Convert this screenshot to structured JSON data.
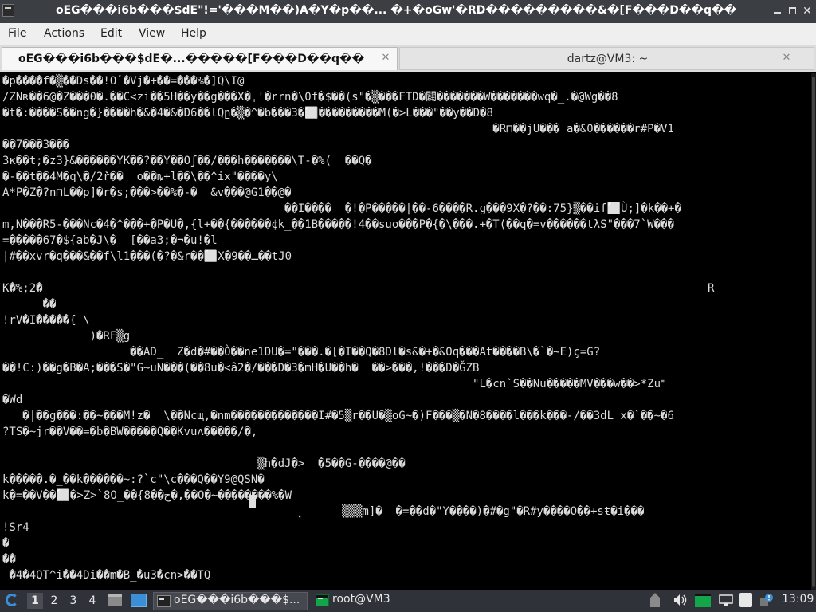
{
  "window": {
    "title": "oEG���i6b���$dE\"!='���M��)A�Y�p��... �+�oGw'�RD���������&�[F���D��q��",
    "minimize_glyph": "",
    "close_glyph": "✕"
  },
  "menubar": {
    "items": [
      "File",
      "Actions",
      "Edit",
      "View",
      "Help"
    ]
  },
  "tabs": [
    {
      "label": "oEG���i6b���$dE�...�����[F���D��q��",
      "active": true
    },
    {
      "label": "dartz@VM3: ~",
      "active": false
    }
  ],
  "tab_close_glyph": "✕",
  "terminal": {
    "lines": [
      "�p����f�▒��Ðs��!Oٴ�Vj�+��=���%�]Q\\I@",
      "/ZNʀ��6@�Z���0�.��C<zi��5H��y��g���X�ˌ'�rrn�\\0f�$��(ѕ\"�▒���FTD�闢�������W������̑�wq�_.�@Wg��8",
      "�t�:����S��ng�}����h�&�4�&�D6��lQը�▒�^�b���3�⬜���������M(�>L���\"��y��D�8",
      "                                                                         �R⊓��jU���_a�&0������r#P�V1",
      "��7���3���",
      "3κ��t;�z3}&������YK��?��Y��Oʃ��/���h�������\\T-�%(  ��Q�",
      "�-��t��4M�q\\�/2ř��  o��ȵ+l��\\��^ix\"����y\\",
      "A*P�Z�?n⊓L��p]�r�s;���>��%�-�  &v���@G1��@�",
      "                                          ��I����  �!�P�����|��-6����R.ɡ���9X�?��:75}▒��if⬜Ù;]�k��+�",
      "m,N���R5-���Nc�4�^���+�P�U�,{l+��{������¢k_��1B�����!4��suo���P�{�\\���.+�T(��q�=v������tλS\"���7`W���",
      "=�����67�${ab�J\\�  [��a3;�¬�u!�l",
      "|#��xvr�q���&��f\\l1���(�?�&r��⬜X�9��ـ��tJ0",
      "",
      "K�%;2�                                                                                                   R",
      "      ��",
      "!rV�I�����{ \\",
      "             )�RF▒g",
      "                   ��AD_  Z�d�#��Ò��ne1DU�=\"���.�[�I��Q�8Dl�s&�+�&Oq���At����B\\�`�~E)ç=G?",
      "��!C:)��g�B�A;���S�\"G~uN���(��8u�<â2�/���D�3�mH�U��h�  ��>���,!���D�ǦZB",
      "                                                                      \"L�cn`S��Nu�����MV���w��>*Zu˭",
      "�Wd",
      "   �|��g���:��~���M!z�  \\��Ncщ,�nm�������������I#�5▒r��U�▒oG~�)F���▒�N�8����l���k���-/��3dL_x�`��~�6",
      "?TS�~jr��V��=�b�BW�����Q��Kvuʌ�����/�,",
      "",
      "                                      ▒h�dJ�>  �5��G-����@��",
      "k�����.�_��k������~:?`c\"\\c���Q��Y9@QSN�",
      "k�=��V��⬜�>Z>`8O_��{8��ح�,��O�~��������%�W",
      "                                            ˻      ▒▒▒m]�  �=��d�\"Y����)�#�g\"�R#y����O��+sŧ�i���",
      "!Sr4",
      "�",
      "��",
      " �4�4QT^i��4Di��m�B_�u3�cn>��TQ"
    ]
  },
  "taskbar": {
    "workspaces": [
      "1",
      "2",
      "3",
      "4"
    ],
    "active_workspace": "1",
    "tasks": [
      {
        "label": "oEG���i6b���$...",
        "active": true
      },
      {
        "label": "root@VM3",
        "active": false
      }
    ],
    "clock": "13:09",
    "colors": {
      "taskbar_bg": "#2f3238",
      "accent": "#3c8fd7",
      "terminal_green": "#13a54a"
    }
  }
}
